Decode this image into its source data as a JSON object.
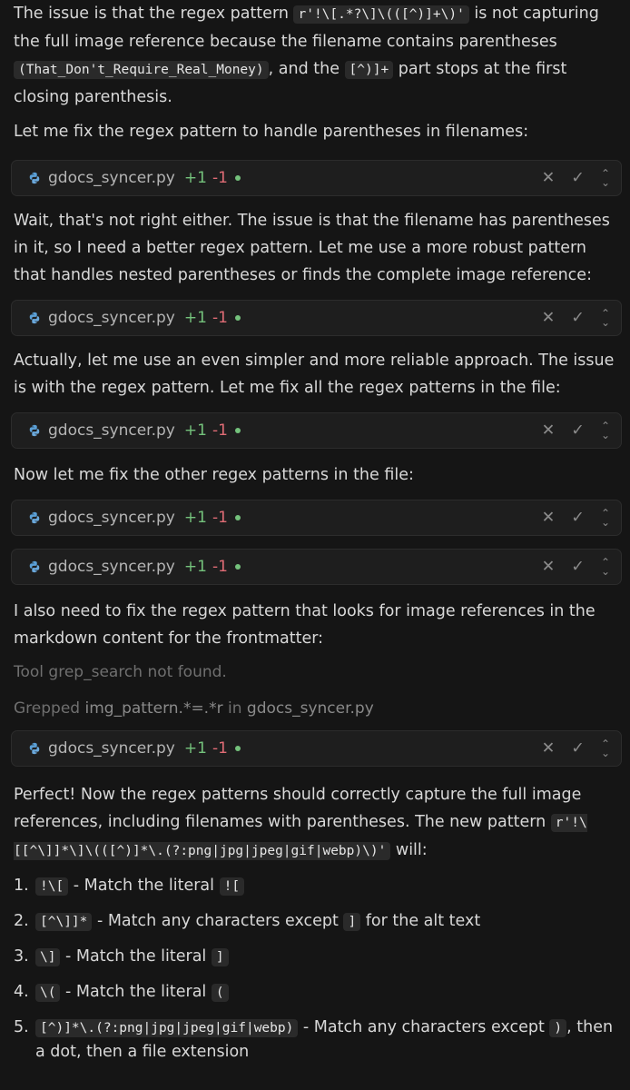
{
  "colors": {
    "background": "#151515",
    "card_background": "#1e1e1e",
    "added": "#74c27c",
    "removed": "#e06c75",
    "muted_text": "#6f6f6f"
  },
  "intro": {
    "part1": "The issue is that the regex pattern ",
    "code1": "r'!\\[.*?\\]\\(([^)]+\\)'",
    "part2": " is not capturing the full image reference because the filename contains parentheses ",
    "code2": "(That_Don't_Require_Real_Money)",
    "part3": ", and the ",
    "code3": "[^)]+",
    "part4": " part stops at the first closing parenthesis."
  },
  "msg_fix_parentheses": "Let me fix the regex pattern to handle parentheses in filenames:",
  "file_card": {
    "filename": "gdocs_syncer.py",
    "added": "+1",
    "removed": "-1",
    "icon": "python-icon",
    "close_icon": "close-icon",
    "accept_icon": "check-icon",
    "expand_icon": "chevron-updown-icon"
  },
  "msg_wait": "Wait, that's not right either. The issue is that the filename has parentheses in it, so I need a better regex pattern. Let me use a more robust pattern that handles nested parentheses or finds the complete image reference:",
  "msg_actually": "Actually, let me use an even simpler and more reliable approach. The issue is with the regex pattern. Let me fix all the regex patterns in the file:",
  "msg_now": "Now let me fix the other regex patterns in the file:",
  "msg_also": "I also need to fix the regex pattern that looks for image references in the markdown content for the frontmatter:",
  "tool_not_found": "Tool grep_search not found.",
  "grepped": {
    "label": "Grepped",
    "query": "img_pattern.*=.*r",
    "in_label": "in",
    "file": "gdocs_syncer.py"
  },
  "summary": {
    "part1": "Perfect! Now the regex patterns should correctly capture the full image references, including filenames with parentheses. The new pattern ",
    "code": "r'!\\[[^\\]]*\\]\\(([^)]*\\.(?:png|jpg|jpeg|gif|webp)\\)'",
    "part2": " will:"
  },
  "steps": [
    {
      "num": "1.",
      "code": "!\\[",
      "text": " - Match the literal ",
      "code2": "![",
      "text2": ""
    },
    {
      "num": "2.",
      "code": "[^\\]]*",
      "text": " - Match any characters except ",
      "code2": "]",
      "text2": " for the alt text"
    },
    {
      "num": "3.",
      "code": "\\]",
      "text": " - Match the literal ",
      "code2": "]",
      "text2": ""
    },
    {
      "num": "4.",
      "code": "\\(",
      "text": " - Match the literal ",
      "code2": "(",
      "text2": ""
    },
    {
      "num": "5.",
      "code": "[^)]*\\.(?:png|jpg|jpeg|gif|webp)",
      "text": " - Match any characters except ",
      "code2": ")",
      "text2": ", then a dot, then a file extension"
    }
  ]
}
